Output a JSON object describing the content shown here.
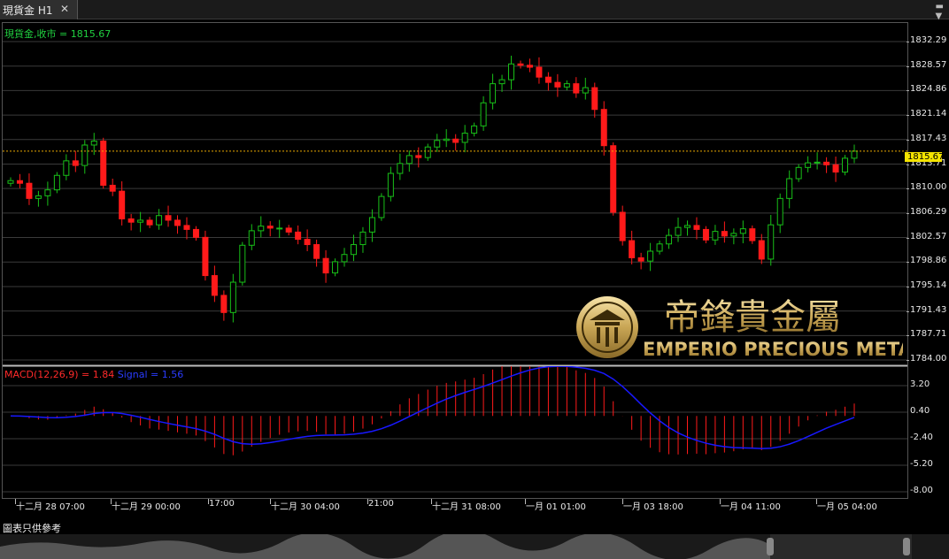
{
  "tab": {
    "title": "現貨金 H1",
    "close": "✕"
  },
  "symbol_label": "現貨金,收市 = 1815.67",
  "current_price": "1815.67",
  "macd_label": {
    "macd": "MACD(12,26,9) = 1.84",
    "signal": "Signal = 1.56"
  },
  "disclaimer": "圖表只供參考",
  "logo": {
    "chinese": "帝鋒貴金屬",
    "english": "EMPERIO PRECIOUS METALS"
  },
  "colors": {
    "up": "#18c018",
    "down": "#ff1a1a",
    "signal": "#1818ff",
    "grid": "#3a3a3a",
    "current": "#e8a800"
  },
  "chart_data": [
    {
      "type": "candlestick",
      "title": "現貨金 H1",
      "ylim": [
        1784.0,
        1832.29
      ],
      "y_ticks": [
        "1832.29",
        "1828.57",
        "1824.86",
        "1821.14",
        "1817.43",
        "1813.71",
        "1810.00",
        "1806.29",
        "1802.57",
        "1798.86",
        "1795.14",
        "1791.43",
        "1787.71",
        "1784.00"
      ],
      "x_ticks": [
        "十二月 28 07:00",
        "十二月 29 00:00",
        "17:00",
        "十二月 30 04:00",
        "21:00",
        "十二月 31 08:00",
        "一月 01 01:00",
        "一月 03 18:00",
        "一月 04 11:00",
        "一月 05 04:00"
      ],
      "close_series": [
        1811.2,
        1810.8,
        1808.5,
        1808.9,
        1809.8,
        1812.0,
        1814.2,
        1813.5,
        1816.6,
        1817.2,
        1810.5,
        1809.6,
        1805.4,
        1804.9,
        1805.2,
        1804.5,
        1805.9,
        1805.2,
        1804.4,
        1803.8,
        1802.6,
        1796.8,
        1793.8,
        1791.2,
        1795.8,
        1801.4,
        1803.6,
        1804.3,
        1804.0,
        1804.0,
        1803.4,
        1802.3,
        1801.5,
        1799.4,
        1797.2,
        1798.9,
        1800.0,
        1801.5,
        1803.4,
        1805.6,
        1808.8,
        1812.3,
        1813.8,
        1815.0,
        1814.7,
        1816.3,
        1817.3,
        1817.5,
        1817.0,
        1818.4,
        1819.5,
        1823.0,
        1825.9,
        1826.5,
        1828.9,
        1828.7,
        1828.4,
        1826.9,
        1826.1,
        1825.4,
        1825.9,
        1824.5,
        1825.3,
        1822.0,
        1816.5,
        1806.4,
        1802.1,
        1799.5,
        1799.0,
        1800.5,
        1801.6,
        1802.9,
        1804.1,
        1804.4,
        1803.8,
        1802.2,
        1803.5,
        1802.8,
        1803.2,
        1803.9,
        1802.1,
        1799.3,
        1804.5,
        1808.5,
        1811.5,
        1813.2,
        1813.9,
        1814.0,
        1813.6,
        1812.5,
        1814.6,
        1815.67
      ],
      "current": 1815.67
    },
    {
      "type": "bar",
      "title": "MACD(12,26,9)",
      "ylim": [
        -8.0,
        3.2
      ],
      "y_ticks": [
        "3.20",
        "0.40",
        "-2.40",
        "-5.20",
        "-8.00"
      ],
      "macd": 1.84,
      "signal": 1.56
    }
  ]
}
